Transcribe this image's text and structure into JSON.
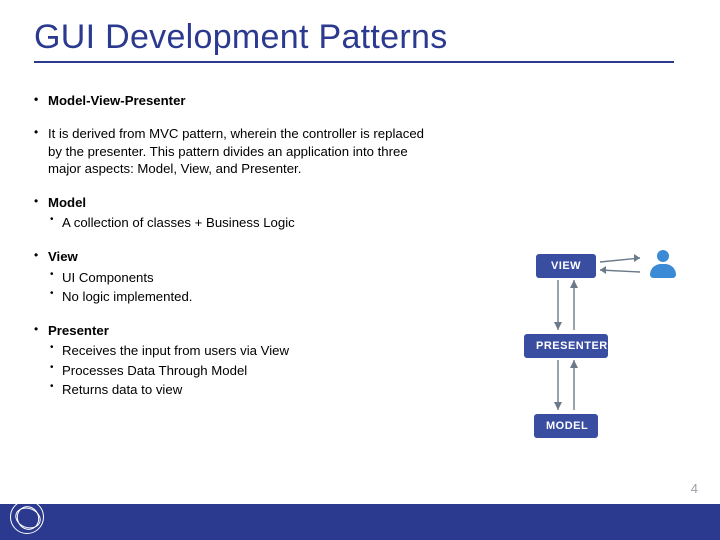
{
  "title": "GUI Development Patterns",
  "bullets": {
    "b0": "Model-View-Presenter",
    "b1": "It is derived from MVC pattern, wherein the controller is replaced by the presenter. This pattern divides an application into three major aspects: Model, View, and Presenter.",
    "model": {
      "head": "Model",
      "s0": "A collection of classes + Business Logic"
    },
    "view": {
      "head": "View",
      "s0": "UI Components",
      "s1": "No logic implemented."
    },
    "presenter": {
      "head": "Presenter",
      "s0": "Receives the input from users via View",
      "s1": "Processes Data Through Model",
      "s2": "Returns data to view"
    }
  },
  "diagram": {
    "view": "VIEW",
    "presenter": "PRESENTER",
    "model": "MODEL"
  },
  "page_number": "4"
}
